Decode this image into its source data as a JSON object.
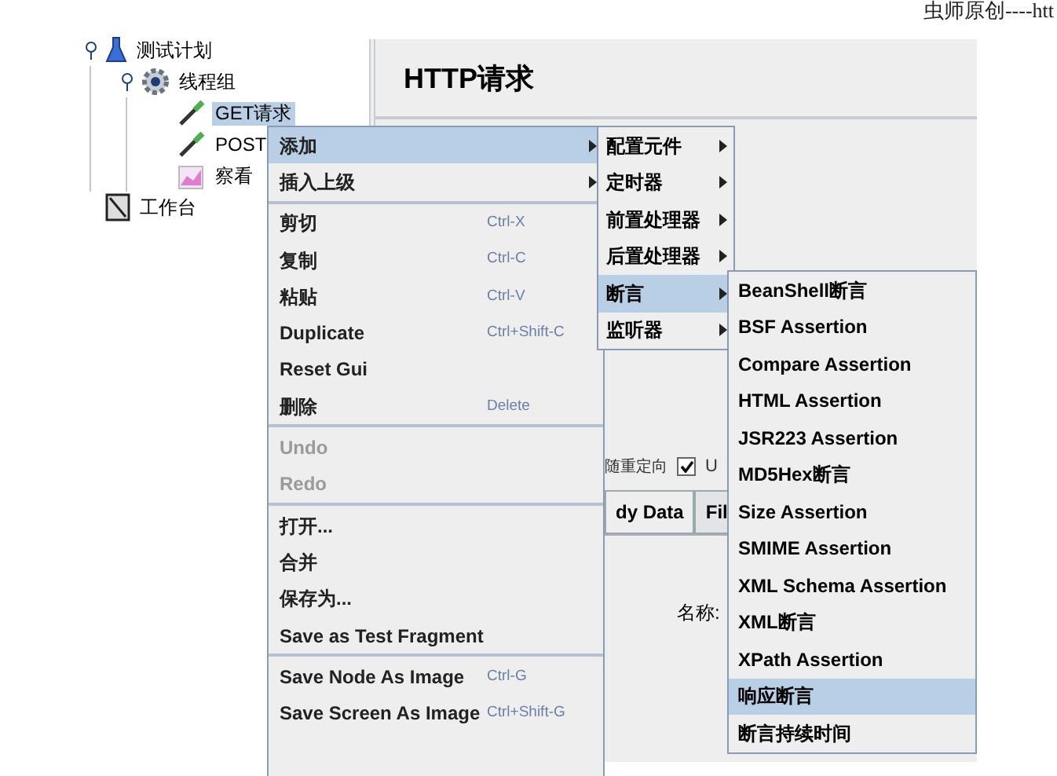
{
  "caption": "虫师原创----htt",
  "tree": [
    {
      "label": "测试计划",
      "kind": "plan",
      "expanded": true,
      "selected": false,
      "children": [
        {
          "label": "线程组",
          "kind": "threads",
          "expanded": true,
          "selected": false,
          "children": [
            {
              "label": "GET请求",
              "kind": "sampler",
              "selected": true
            },
            {
              "label": "POST",
              "kind": "sampler",
              "selected": false
            },
            {
              "label": "察看",
              "kind": "listener",
              "selected": false
            }
          ]
        }
      ]
    },
    {
      "label": "工作台",
      "kind": "workbench",
      "selected": false
    }
  ],
  "panel": {
    "title": "HTTP请求",
    "redirect_label": "随重定向",
    "redirect_checked": true,
    "redirect_next": "U",
    "tabs": [
      {
        "label": "dy Data",
        "selected": true
      },
      {
        "label": "Fil",
        "selected": false
      }
    ],
    "name_label": "名称:"
  },
  "context_menu": [
    [
      {
        "label": "添加",
        "submenu": true,
        "selected": true,
        "disabled": false
      },
      {
        "label": "插入上级",
        "submenu": true,
        "selected": false,
        "disabled": false
      }
    ],
    [
      {
        "label": "剪切",
        "shortcut": "Ctrl-X",
        "selected": false,
        "disabled": false
      },
      {
        "label": "复制",
        "shortcut": "Ctrl-C",
        "selected": false,
        "disabled": false
      },
      {
        "label": "粘贴",
        "shortcut": "Ctrl-V",
        "selected": false,
        "disabled": false
      },
      {
        "label": "Duplicate",
        "shortcut": "Ctrl+Shift-C",
        "selected": false,
        "disabled": false
      },
      {
        "label": "Reset Gui",
        "selected": false,
        "disabled": false
      },
      {
        "label": "删除",
        "shortcut": "Delete",
        "selected": false,
        "disabled": false
      }
    ],
    [
      {
        "label": "Undo",
        "selected": false,
        "disabled": true
      },
      {
        "label": "Redo",
        "selected": false,
        "disabled": true
      }
    ],
    [
      {
        "label": "打开...",
        "selected": false,
        "disabled": false
      },
      {
        "label": "合并",
        "selected": false,
        "disabled": false
      },
      {
        "label": "保存为...",
        "selected": false,
        "disabled": false
      },
      {
        "label": "Save as Test Fragment",
        "selected": false,
        "disabled": false
      }
    ],
    [
      {
        "label": "Save Node As Image",
        "shortcut": "Ctrl-G",
        "selected": false,
        "disabled": false
      },
      {
        "label": "Save Screen As Image",
        "shortcut": "Ctrl+Shift-G",
        "selected": false,
        "disabled": false
      }
    ]
  ],
  "add_submenu": [
    {
      "label": "配置元件",
      "selected": false
    },
    {
      "label": "定时器",
      "selected": false
    },
    {
      "label": "前置处理器",
      "selected": false
    },
    {
      "label": "后置处理器",
      "selected": false
    },
    {
      "label": "断言",
      "selected": true
    },
    {
      "label": "监听器",
      "selected": false
    }
  ],
  "assertion_submenu": [
    {
      "label": "BeanShell断言",
      "selected": false
    },
    {
      "label": "BSF Assertion",
      "selected": false
    },
    {
      "label": "Compare Assertion",
      "selected": false
    },
    {
      "label": "HTML Assertion",
      "selected": false
    },
    {
      "label": "JSR223 Assertion",
      "selected": false
    },
    {
      "label": "MD5Hex断言",
      "selected": false
    },
    {
      "label": "Size Assertion",
      "selected": false
    },
    {
      "label": "SMIME Assertion",
      "selected": false
    },
    {
      "label": "XML Schema Assertion",
      "selected": false
    },
    {
      "label": "XML断言",
      "selected": false
    },
    {
      "label": "XPath Assertion",
      "selected": false
    },
    {
      "label": "响应断言",
      "selected": true
    },
    {
      "label": "断言持续时间",
      "selected": false
    }
  ]
}
